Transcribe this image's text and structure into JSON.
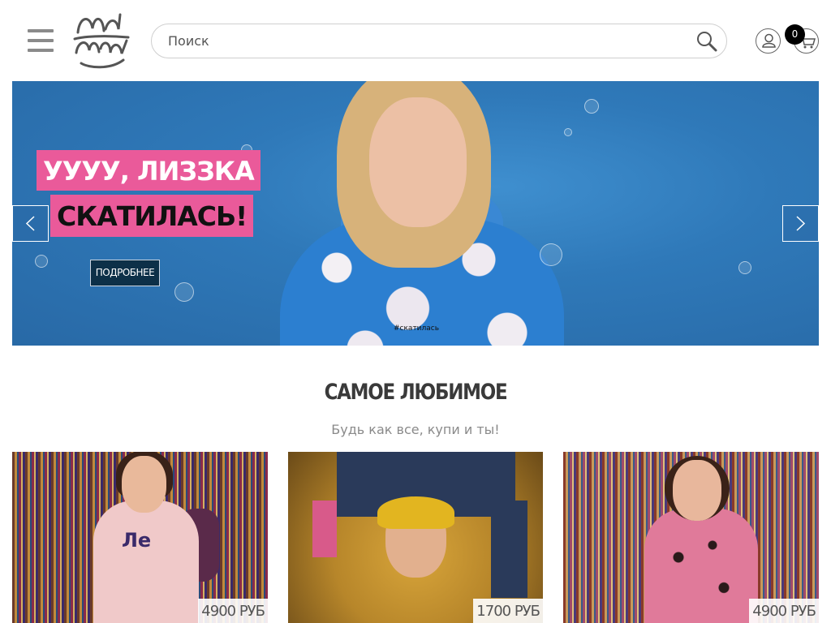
{
  "header": {
    "search": {
      "placeholder": "Поиск",
      "value": ""
    },
    "cart": {
      "count": "0"
    }
  },
  "hero": {
    "line1": "УУУУ, ЛИЗЗКА",
    "line2": "СКАТИЛАСЬ!",
    "more_label": "ПОДРОБНЕЕ",
    "hoodie_print": "#скатилась"
  },
  "section": {
    "title": "САМОЕ ЛЮБИМОЕ",
    "subtitle": "Будь как все, купи и ты!"
  },
  "products": [
    {
      "price": "4900 РУБ",
      "print": "Ле"
    },
    {
      "price": "1700 РУБ"
    },
    {
      "price": "4900 РУБ"
    }
  ],
  "colors": {
    "accent_pink": "#ea5a9a",
    "hero_blue": "#2f79b9",
    "button_dark": "#0d3048"
  }
}
